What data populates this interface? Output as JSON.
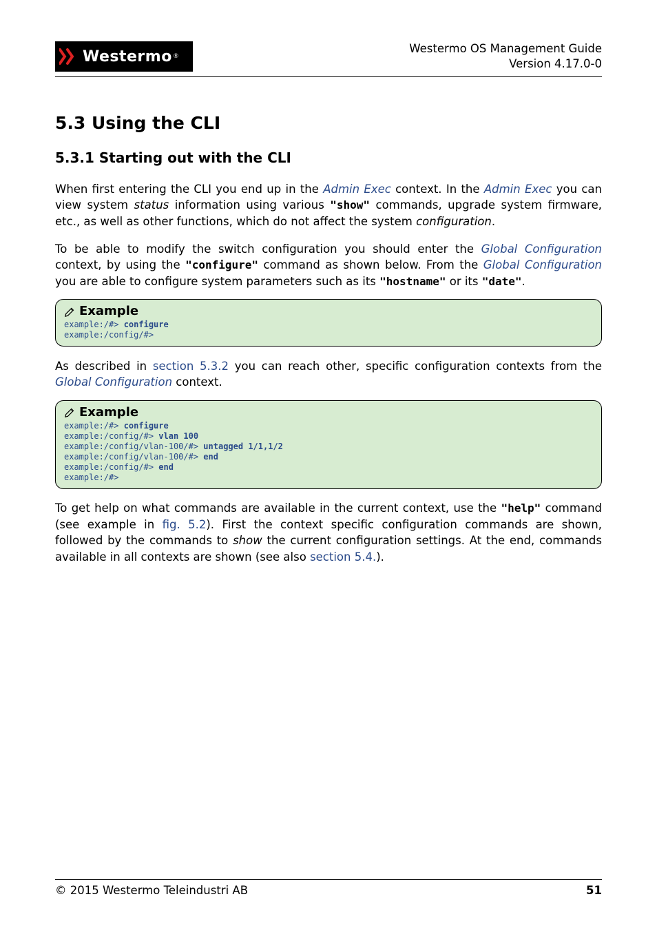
{
  "header": {
    "logo_text": "Westermo",
    "doc_title": "Westermo OS Management Guide",
    "version": "Version 4.17.0-0"
  },
  "sections": {
    "h2": "5.3   Using the CLI",
    "h3": "5.3.1   Starting out with the CLI"
  },
  "paragraphs": {
    "p1_a": "When first entering the CLI you end up in the ",
    "p1_link1": "Admin Exec",
    "p1_b": " context. In the ",
    "p1_link2": "Admin Exec",
    "p1_c": " you can view system ",
    "p1_ital1": "status",
    "p1_d": " information using various ",
    "p1_code1": "\"show\"",
    "p1_e": " commands, upgrade system firmware, etc., as well as other functions, which do not affect the system ",
    "p1_ital2": "configuration",
    "p1_f": ".",
    "p2_a": "To be able to modify the switch configuration you should enter the ",
    "p2_link1": "Global Configuration",
    "p2_b": " context, by using the ",
    "p2_code1": "\"configure\"",
    "p2_c": " command as shown below. From the ",
    "p2_link2": "Global Configuration",
    "p2_d": " you are able to configure system parameters such as its ",
    "p2_code2": "\"hostname\"",
    "p2_e": " or its ",
    "p2_code3": "\"date\"",
    "p2_f": ".",
    "p3_a": "As described in ",
    "p3_link1": "section 5.3.2",
    "p3_b": " you can reach other, specific configuration contexts from the ",
    "p3_link2": "Global Configuration",
    "p3_c": " context.",
    "p4_a": "To get help on what commands are available in the current context, use the ",
    "p4_code1": "\"help\"",
    "p4_b": " command (see example in ",
    "p4_link1": "fig. 5.2",
    "p4_c": "). First the context specific configuration commands are shown, followed by the commands to ",
    "p4_ital1": "show",
    "p4_d": " the current configuration settings. At the end, commands available in all contexts are shown (see also ",
    "p4_link2": "section 5.4.",
    "p4_e": ")."
  },
  "examples": {
    "title": "Example",
    "ex1": {
      "l1_prompt": "example:/#> ",
      "l1_cmd": "configure",
      "l2_prompt": "example:/config/#>"
    },
    "ex2": {
      "l1_prompt": "example:/#> ",
      "l1_cmd": "configure",
      "l2_prompt": "example:/config/#> ",
      "l2_cmd": "vlan 100",
      "l3_prompt": "example:/config/vlan-100/#> ",
      "l3_cmd": "untagged 1/1,1/2",
      "l4_prompt": "example:/config/vlan-100/#> ",
      "l4_cmd": "end",
      "l5_prompt": "example:/config/#> ",
      "l5_cmd": "end",
      "l6_prompt": "example:/#>"
    }
  },
  "footer": {
    "copyright": "© 2015 Westermo Teleindustri AB",
    "page": "51"
  }
}
